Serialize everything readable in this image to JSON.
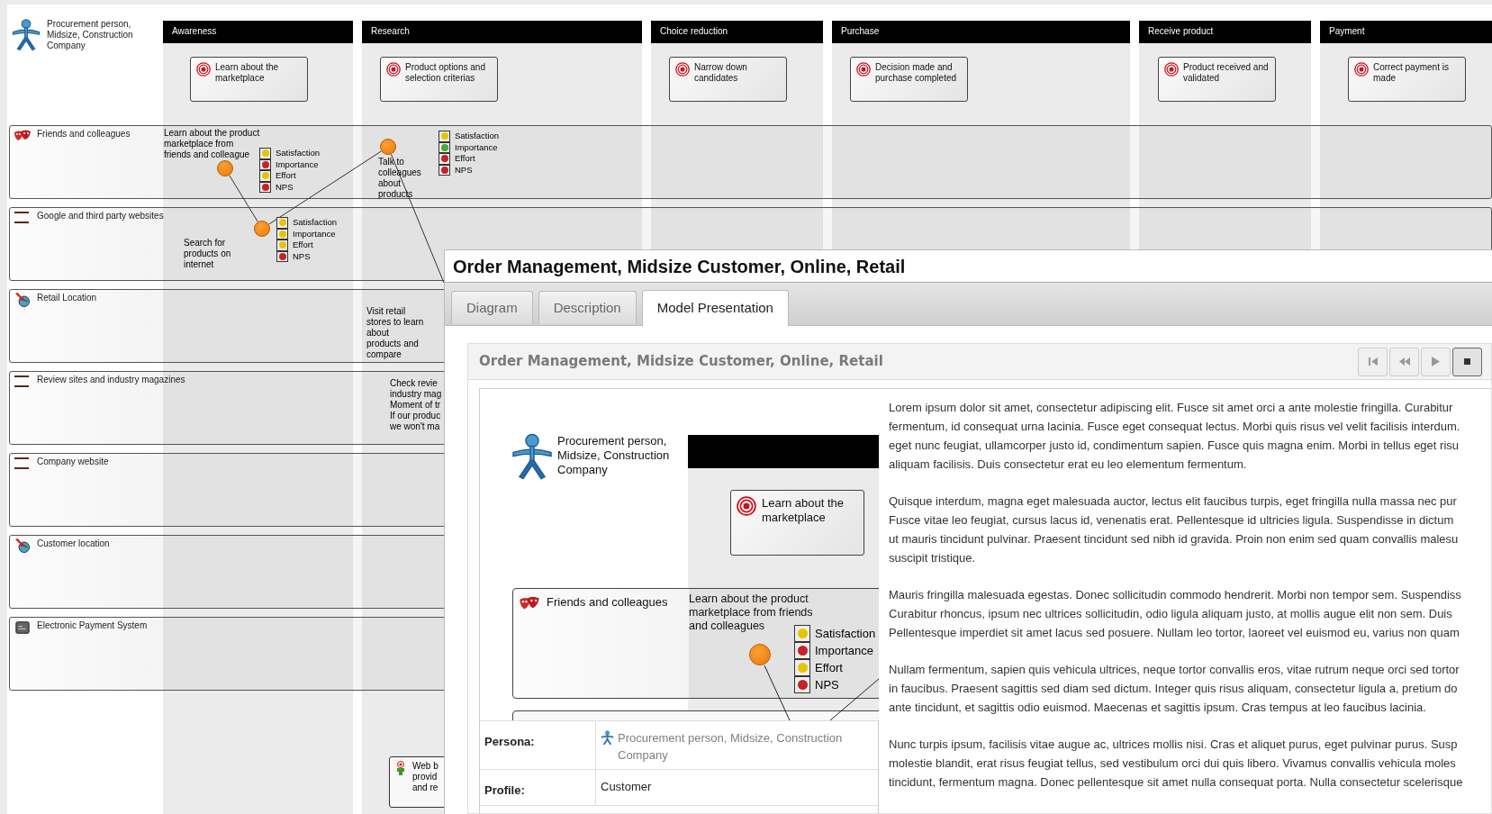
{
  "persona": {
    "name": "Procurement person, Midsize, Construction Company"
  },
  "stages": [
    {
      "name": "Awareness",
      "goal": "Learn about the marketplace"
    },
    {
      "name": "Research",
      "goal": "Product options and selection criterias"
    },
    {
      "name": "Choice reduction",
      "goal": "Narrow down candidates"
    },
    {
      "name": "Purchase",
      "goal": "Decision made and purchase completed"
    },
    {
      "name": "Receive product",
      "goal": "Product received and validated"
    },
    {
      "name": "Payment",
      "goal": "Correct payment is made"
    }
  ],
  "lanes": [
    {
      "name": "Friends and colleagues",
      "kind": "people"
    },
    {
      "name": "Google and third party websites",
      "kind": "media"
    },
    {
      "name": "Retail Location",
      "kind": "location"
    },
    {
      "name": "Review sites and industry magazines",
      "kind": "media"
    },
    {
      "name": "Company website",
      "kind": "media"
    },
    {
      "name": "Customer location",
      "kind": "location"
    },
    {
      "name": "Electronic Payment System",
      "kind": "system"
    }
  ],
  "touchpoints": [
    {
      "kind": "node",
      "text": "Learn about the product\nmarketplace from\nfriends and colleague",
      "metrics": [
        {
          "name": "Satisfaction",
          "color": "#e8c400"
        },
        {
          "name": "Importance",
          "color": "#c8202a"
        },
        {
          "name": "Effort",
          "color": "#e8c400"
        },
        {
          "name": "NPS",
          "color": "#c8202a"
        }
      ]
    },
    {
      "kind": "node",
      "text": "Search for\nproducts on\ninternet",
      "metrics": [
        {
          "name": "Satisfaction",
          "color": "#e8c400"
        },
        {
          "name": "Importance",
          "color": "#e8c400"
        },
        {
          "name": "Effort",
          "color": "#e8c400"
        },
        {
          "name": "NPS",
          "color": "#c8202a"
        }
      ]
    },
    {
      "kind": "node",
      "text": "Talk to\ncolleagues\nabout\nproducts",
      "metrics": [
        {
          "name": "Satisfaction",
          "color": "#e8c400"
        },
        {
          "name": "Importance",
          "color": "#4aa832"
        },
        {
          "name": "Effort",
          "color": "#c8202a"
        },
        {
          "name": "NPS",
          "color": "#c8202a"
        }
      ]
    },
    {
      "kind": "note",
      "text": "Visit retail\nstores to learn\nabout\nproducts and\ncompare"
    },
    {
      "kind": "note",
      "text": "Check revie\nindustry mag\nMoment of tr\nIf our produc\nwe won't ma"
    },
    {
      "kind": "card",
      "text": "Web b\nprovid\nand re"
    }
  ],
  "overlay": {
    "title": "Order Management, Midsize Customer, Online, Retail",
    "tabs": [
      {
        "label": "Diagram",
        "selected": false
      },
      {
        "label": "Description",
        "selected": false
      },
      {
        "label": "Model Presentation",
        "selected": true
      }
    ],
    "presentation_title": "Order Management, Midsize Customer, Online, Retail",
    "player_buttons": [
      {
        "kind": "first",
        "selected": false
      },
      {
        "kind": "rewind",
        "selected": false
      },
      {
        "kind": "play",
        "selected": false
      },
      {
        "kind": "stop",
        "selected": true
      }
    ],
    "preview": {
      "persona": "Procurement person,\nMidsize, Construction\nCompany",
      "goal": "Learn about the\nmarketplace",
      "lane": "Friends and colleagues",
      "touchpoint": "Learn about the product\nmarketplace from friends\nand colleagues",
      "metrics": [
        {
          "name": "Satisfaction",
          "color": "#e8c400"
        },
        {
          "name": "Importance",
          "color": "#c8202a"
        },
        {
          "name": "Effort",
          "color": "#e8c400"
        },
        {
          "name": "NPS",
          "color": "#c8202a"
        }
      ]
    },
    "details": [
      {
        "kind": "persona",
        "label": "Persona:",
        "value": "Procurement person, Midsize, Construction Company"
      },
      {
        "kind": "text",
        "label": "Profile:",
        "value": "Customer"
      }
    ],
    "paragraphs": [
      "Lorem ipsum dolor sit amet, consectetur adipiscing elit. Fusce sit amet orci a ante molestie fringilla. Curabitur\nfermentum, id consequat urna lacinia. Fusce eget consequat lectus. Morbi quis risus vel velit facilisis interdum.\neget nunc feugiat, ullamcorper justo id, condimentum sapien. Fusce quis magna enim. Morbi in tellus eget risu\naliquam facilisis. Duis consectetur erat eu leo elementum fermentum.",
      "Quisque interdum, magna eget malesuada auctor, lectus elit faucibus turpis, eget fringilla nulla massa nec pur\nFusce vitae leo feugiat, cursus lacus id, venenatis erat. Pellentesque id ultricies ligula. Suspendisse in dictum\nut mauris tincidunt pulvinar. Praesent tincidunt sed nibh id gravida. Proin non enim sed quam convallis malesu\nsuscipit tristique.",
      "Mauris fringilla malesuada egestas. Donec sollicitudin commodo hendrerit. Morbi non tempor sem. Suspendiss\nCurabitur rhoncus, ipsum nec ultrices sollicitudin, odio ligula aliquam justo, at mollis augue elit non sem. Duis\nPellentesque imperdiet sit amet lacus sed posuere. Nullam leo tortor, laoreet vel euismod eu, varius non quam",
      "Nullam fermentum, sapien quis vehicula ultrices, neque tortor convallis eros, vitae rutrum neque orci sed tortor\nin faucibus. Praesent sagittis sed diam sed dictum. Integer quis risus aliquam, consectetur ligula a, pretium do\nante tincidunt, et sagittis odio euismod. Maecenas et sagittis ipsum. Cras tempus at leo faucibus lacinia.",
      "Nunc turpis ipsum, facilisis vitae augue ac, ultrices mollis nisi. Cras et aliquet purus, eget pulvinar purus. Susp\nmolestie blandit, erat risus feugiat tellus, sed vestibulum orci dui quis libero. Vivamus convallis vehicula moles\ntincidunt, fermentum magna. Donec pellentesque sit amet nulla consequat porta. Nulla consectetur scelerisque"
    ]
  }
}
